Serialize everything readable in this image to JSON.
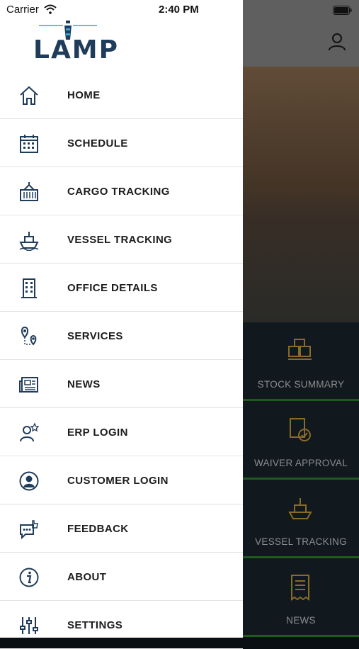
{
  "status_bar": {
    "carrier": "Carrier",
    "time": "2:40 PM"
  },
  "brand": {
    "logo_text": "LAMP",
    "accent": "#1f3c5a",
    "highlight": "#2fa8e0"
  },
  "drawer": {
    "items": [
      {
        "label": "HOME",
        "icon": "home-icon"
      },
      {
        "label": "SCHEDULE",
        "icon": "calendar-icon"
      },
      {
        "label": "CARGO TRACKING",
        "icon": "cargo-container-icon"
      },
      {
        "label": "VESSEL TRACKING",
        "icon": "ship-icon"
      },
      {
        "label": "OFFICE DETAILS",
        "icon": "building-icon"
      },
      {
        "label": "SERVICES",
        "icon": "location-pins-icon"
      },
      {
        "label": "NEWS",
        "icon": "newspaper-icon"
      },
      {
        "label": "ERP LOGIN",
        "icon": "user-star-icon"
      },
      {
        "label": "CUSTOMER LOGIN",
        "icon": "user-circle-icon"
      },
      {
        "label": "FEEDBACK",
        "icon": "feedback-chat-icon"
      },
      {
        "label": "ABOUT",
        "icon": "info-icon"
      },
      {
        "label": "SETTINGS",
        "icon": "sliders-icon"
      }
    ]
  },
  "background": {
    "tiles": [
      {
        "label": "STOCK SUMMARY",
        "icon": "boxes-icon"
      },
      {
        "label": "WAIVER APPROVAL",
        "icon": "approval-document-icon"
      },
      {
        "label": "VESSEL TRACKING",
        "icon": "ship-location-icon"
      },
      {
        "label": "NEWS",
        "icon": "receipt-icon"
      }
    ]
  }
}
